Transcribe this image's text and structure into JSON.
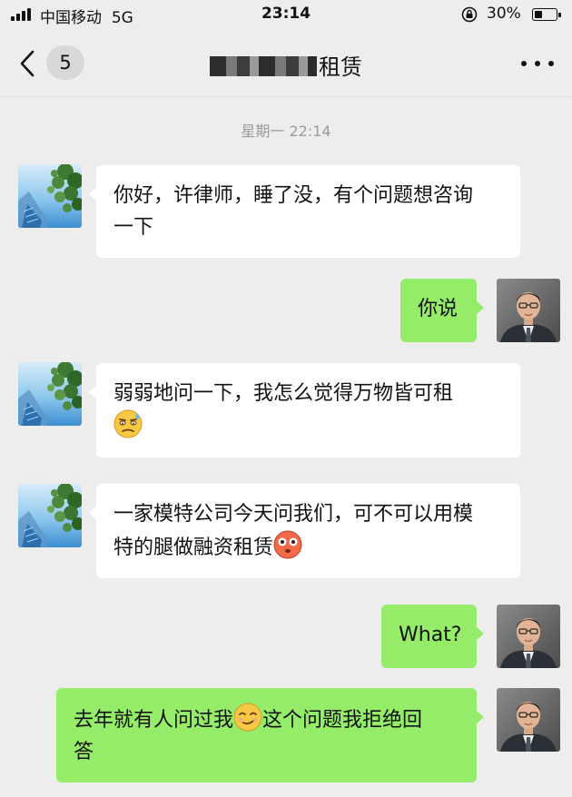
{
  "status_bar": {
    "carrier": "中国移动",
    "network": "5G",
    "time": "23:14",
    "battery": "30%",
    "battery_level": 0.3
  },
  "nav": {
    "unread_count": "5",
    "title": "租赁",
    "back_icon": "chevron-left-icon",
    "more_icon": "more-dots-icon"
  },
  "conversation": {
    "timestamp": "星期一 22:14",
    "messages": [
      {
        "side": "left",
        "text_1": "你好，许律师，睡了没，有个问题想咨询",
        "text_2": "一下"
      },
      {
        "side": "right",
        "text_1": "你说"
      },
      {
        "side": "left",
        "text_1": "弱弱地问一下，我怎么觉得万物皆可租",
        "emoji": "sweat-smile-emoji"
      },
      {
        "side": "left",
        "text_1": "一家模特公司今天问我们，可不可以用模",
        "text_2": "特的腿做融资租赁",
        "emoji": "flushed-emoji"
      },
      {
        "side": "right",
        "text_1": "What?"
      },
      {
        "side": "right",
        "text_1": "去年就有人问过我",
        "emoji": "smirk-emoji",
        "text_2": "这个问题我拒绝回",
        "text_3": "答"
      }
    ]
  },
  "colors": {
    "background": "#ededed",
    "incoming_bubble": "#ffffff",
    "outgoing_bubble": "#95ec69",
    "timestamp_text": "#9b9b9b"
  }
}
